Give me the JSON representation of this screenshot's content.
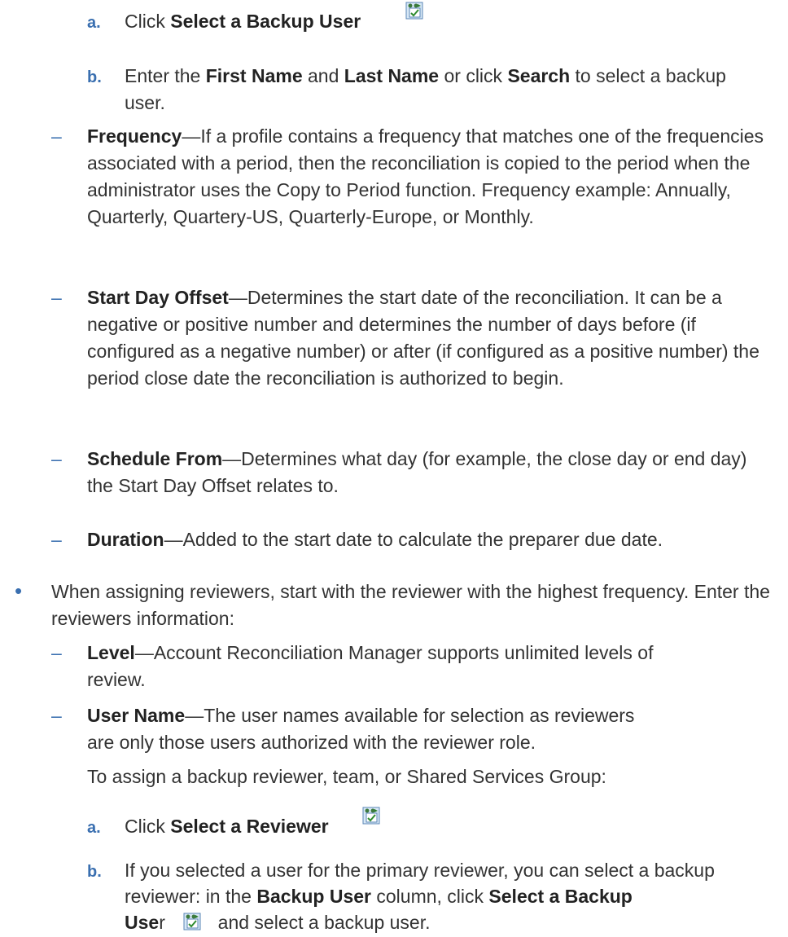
{
  "step_a1": {
    "marker": "a.",
    "pre": "Click ",
    "bold": "Select a Backup User"
  },
  "step_b1": {
    "marker": "b.",
    "t1": "Enter the ",
    "b1": "First Name",
    "t2": " and ",
    "b2": "Last Name",
    "t3": " or click ",
    "b3": "Search",
    "t4": " to select a backup user."
  },
  "frequency": {
    "marker": "–",
    "term": "Frequency",
    "text": "—If a profile contains a frequency that matches one of the frequencies associated with a period, then the reconciliation is copied to the period when the administrator uses the Copy to Period function. Frequency example: Annually, Quarterly, Quartery-US, Quarterly-Europe, or Monthly."
  },
  "start_offset": {
    "marker": "–",
    "term": "Start Day Offset",
    "text": "—Determines the start date of the reconciliation. It can be a negative or positive number and determines the number of days before (if configured as a negative number) or after (if configured as a positive number) the period close date the reconciliation is authorized to begin."
  },
  "schedule_from": {
    "marker": "–",
    "term": "Schedule From",
    "text": "—Determines what day (for example, the close day or end day) the Start Day Offset relates to."
  },
  "duration": {
    "marker": "–",
    "term": "Duration",
    "text": "—Added to the start date to calculate the preparer due date."
  },
  "reviewers_bullet": {
    "marker": "•",
    "text": "When assigning reviewers, start with the reviewer with the highest frequency. Enter the reviewers information:"
  },
  "level": {
    "marker": "–",
    "term": "Level",
    "text": "—Account Reconciliation Manager supports unlimited levels of review."
  },
  "user_name": {
    "marker": "–",
    "term": "User Name",
    "text": "—The user names available for selection as reviewers are only those users authorized with the reviewer role."
  },
  "assign_note": "To assign a backup reviewer, team, or Shared Services Group:",
  "step_a2": {
    "marker": "a.",
    "pre": "Click ",
    "bold": "Select a Reviewer"
  },
  "step_b2": {
    "marker": "b.",
    "t1": "If you selected a user for the primary reviewer, you can select a backup reviewer: in the ",
    "b1": "Backup User",
    "t2": " column, click ",
    "b2": "Select a Backup",
    "b3": "Use",
    "t3": "r",
    "t4": " and select a backup user."
  },
  "icon_name": "select-user-icon"
}
